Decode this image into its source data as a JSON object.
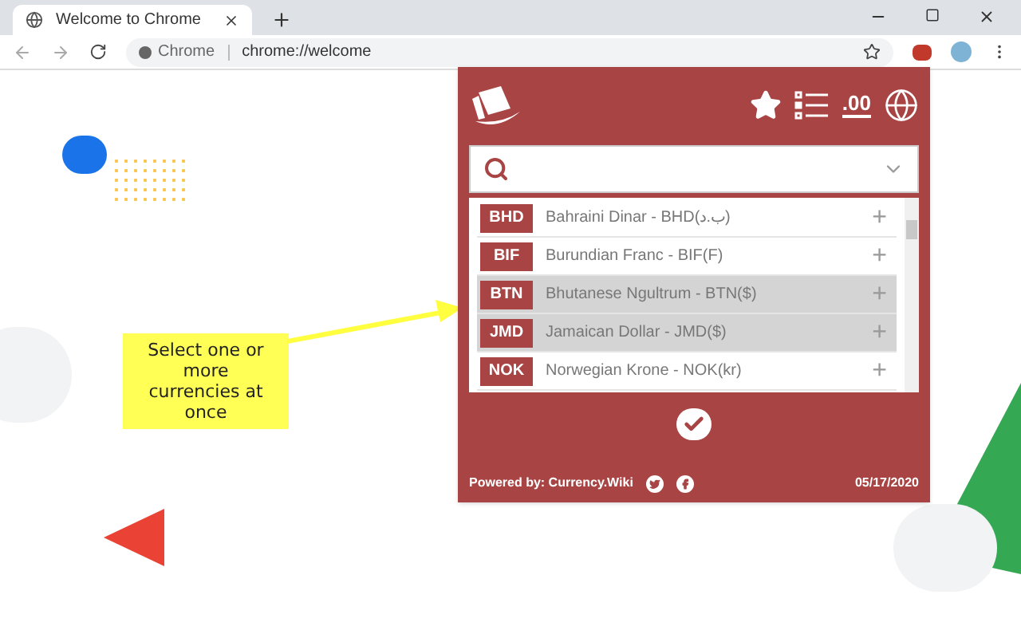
{
  "browser": {
    "tab_title": "Welcome to Chrome",
    "site_label": "Chrome",
    "url": "chrome://welcome"
  },
  "popup": {
    "currencies": [
      {
        "code": "BHD",
        "name": "Bahraini Dinar - BHD(ب.د)",
        "selected": false
      },
      {
        "code": "BIF",
        "name": "Burundian Franc - BIF(F)",
        "selected": false
      },
      {
        "code": "BTN",
        "name": "Bhutanese Ngultrum - BTN($)",
        "selected": true
      },
      {
        "code": "JMD",
        "name": "Jamaican Dollar - JMD($)",
        "selected": true
      },
      {
        "code": "NOK",
        "name": "Norwegian Krone - NOK(kr)",
        "selected": false
      }
    ],
    "add_symbol": "+",
    "decimal_label": ".00",
    "footer": {
      "powered_by": "Powered by: Currency.Wiki",
      "date": "05/17/2020"
    }
  },
  "callout": {
    "text": "Select one or more currencies at once"
  }
}
